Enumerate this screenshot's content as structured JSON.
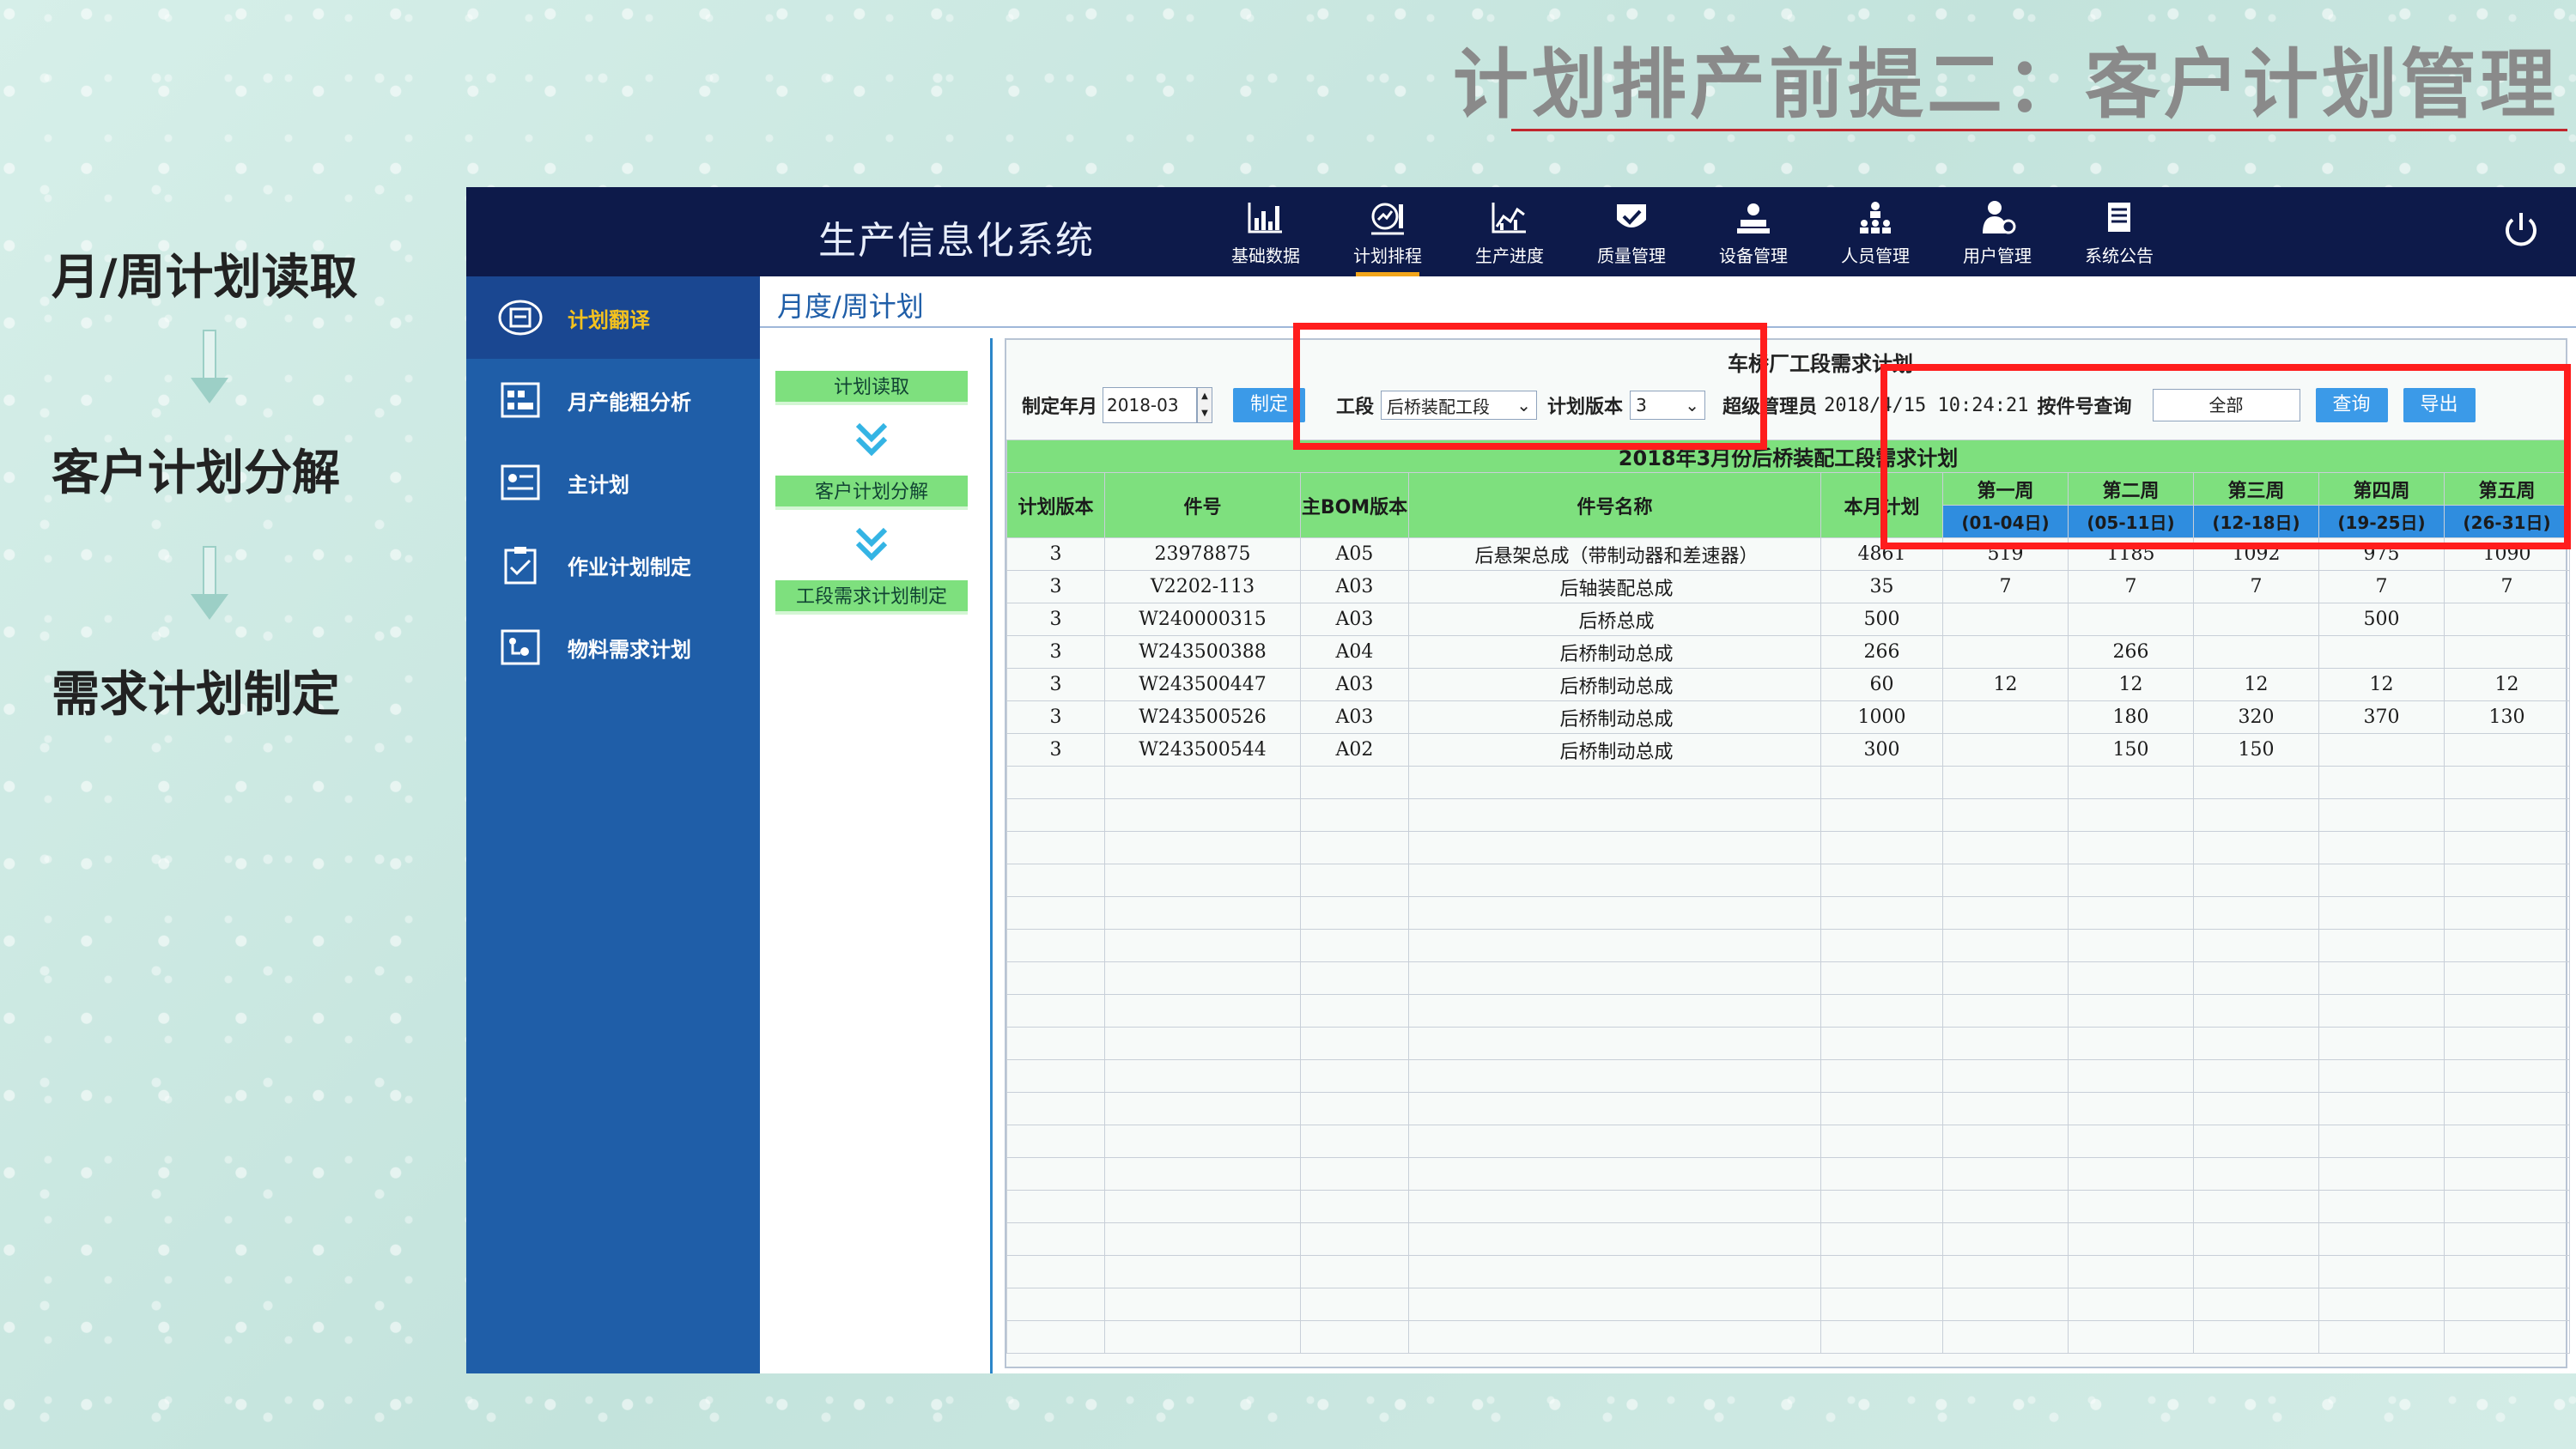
{
  "slide": {
    "title": "计划排产前提二：客户计划管理",
    "steps": [
      "月/周计划读取",
      "客户计划分解",
      "需求计划制定"
    ]
  },
  "app": {
    "name": "生产信息化系统",
    "nav": [
      {
        "label": "基础数据",
        "icon": "bar-chart-icon"
      },
      {
        "label": "计划排程",
        "icon": "plan-schedule-icon"
      },
      {
        "label": "生产进度",
        "icon": "line-chart-icon"
      },
      {
        "label": "质量管理",
        "icon": "quality-shield-icon"
      },
      {
        "label": "设备管理",
        "icon": "equipment-icon"
      },
      {
        "label": "人员管理",
        "icon": "org-chart-icon"
      },
      {
        "label": "用户管理",
        "icon": "user-icon"
      },
      {
        "label": "系统公告",
        "icon": "notice-icon"
      }
    ],
    "active_nav": "计划排程",
    "sidebar": [
      {
        "label": "计划翻译",
        "icon": "translate-icon"
      },
      {
        "label": "月产能粗分析",
        "icon": "capacity-icon"
      },
      {
        "label": "主计划",
        "icon": "master-plan-icon"
      },
      {
        "label": "作业计划制定",
        "icon": "clipboard-check-icon"
      },
      {
        "label": "物料需求计划",
        "icon": "material-icon"
      }
    ],
    "page_heading": "月度/周计划",
    "process": [
      "计划读取",
      "客户计划分解",
      "工段需求计划制定"
    ]
  },
  "panel": {
    "title": "车桥厂工段需求计划",
    "toolbar": {
      "date_label": "制定年月",
      "date_value": "2018-03",
      "make_button": "制定",
      "section_label": "工段",
      "section_value": "后桥装配工段",
      "version_label": "计划版本",
      "version_value": "3",
      "user_info": "超级管理员",
      "timestamp": "2018/4/15 10:24:21",
      "part_query_label": "按件号查询",
      "part_query_value": "全部",
      "query_button": "查询",
      "export_button": "导出"
    },
    "grid": {
      "caption": "2018年3月份后桥装配工段需求计划",
      "columns": [
        "计划版本",
        "件号",
        "主BOM版本",
        "件号名称",
        "本月计划"
      ],
      "weeks": [
        {
          "name": "第一周",
          "range": "(01-04日)"
        },
        {
          "name": "第二周",
          "range": "(05-11日)"
        },
        {
          "name": "第三周",
          "range": "(12-18日)"
        },
        {
          "name": "第四周",
          "range": "(19-25日)"
        },
        {
          "name": "第五周",
          "range": "(26-31日)"
        }
      ],
      "rows": [
        [
          "3",
          "23978875",
          "A05",
          "后悬架总成（带制动器和差速器）",
          "4861",
          "519",
          "1185",
          "1092",
          "975",
          "1090"
        ],
        [
          "3",
          "V2202-113",
          "A03",
          "后轴装配总成",
          "35",
          "7",
          "7",
          "7",
          "7",
          "7"
        ],
        [
          "3",
          "W240000315",
          "A03",
          "后桥总成",
          "500",
          "",
          "",
          "",
          "500",
          ""
        ],
        [
          "3",
          "W243500388",
          "A04",
          "后桥制动总成",
          "266",
          "",
          "266",
          "",
          "",
          ""
        ],
        [
          "3",
          "W243500447",
          "A03",
          "后桥制动总成",
          "60",
          "12",
          "12",
          "12",
          "12",
          "12"
        ],
        [
          "3",
          "W243500526",
          "A03",
          "后桥制动总成",
          "1000",
          "",
          "180",
          "320",
          "370",
          "130"
        ],
        [
          "3",
          "W243500544",
          "A02",
          "后桥制动总成",
          "300",
          "",
          "150",
          "150",
          "",
          ""
        ]
      ]
    }
  },
  "colors": {
    "header_bg": "#0d1a4a",
    "sidebar_bg": "#1f5ea8",
    "grid_header_green": "#7ee07e",
    "week_subheader_blue": "#2f8ddf",
    "highlight_red": "#ff1d1d",
    "active_accent": "#f2a51a"
  }
}
